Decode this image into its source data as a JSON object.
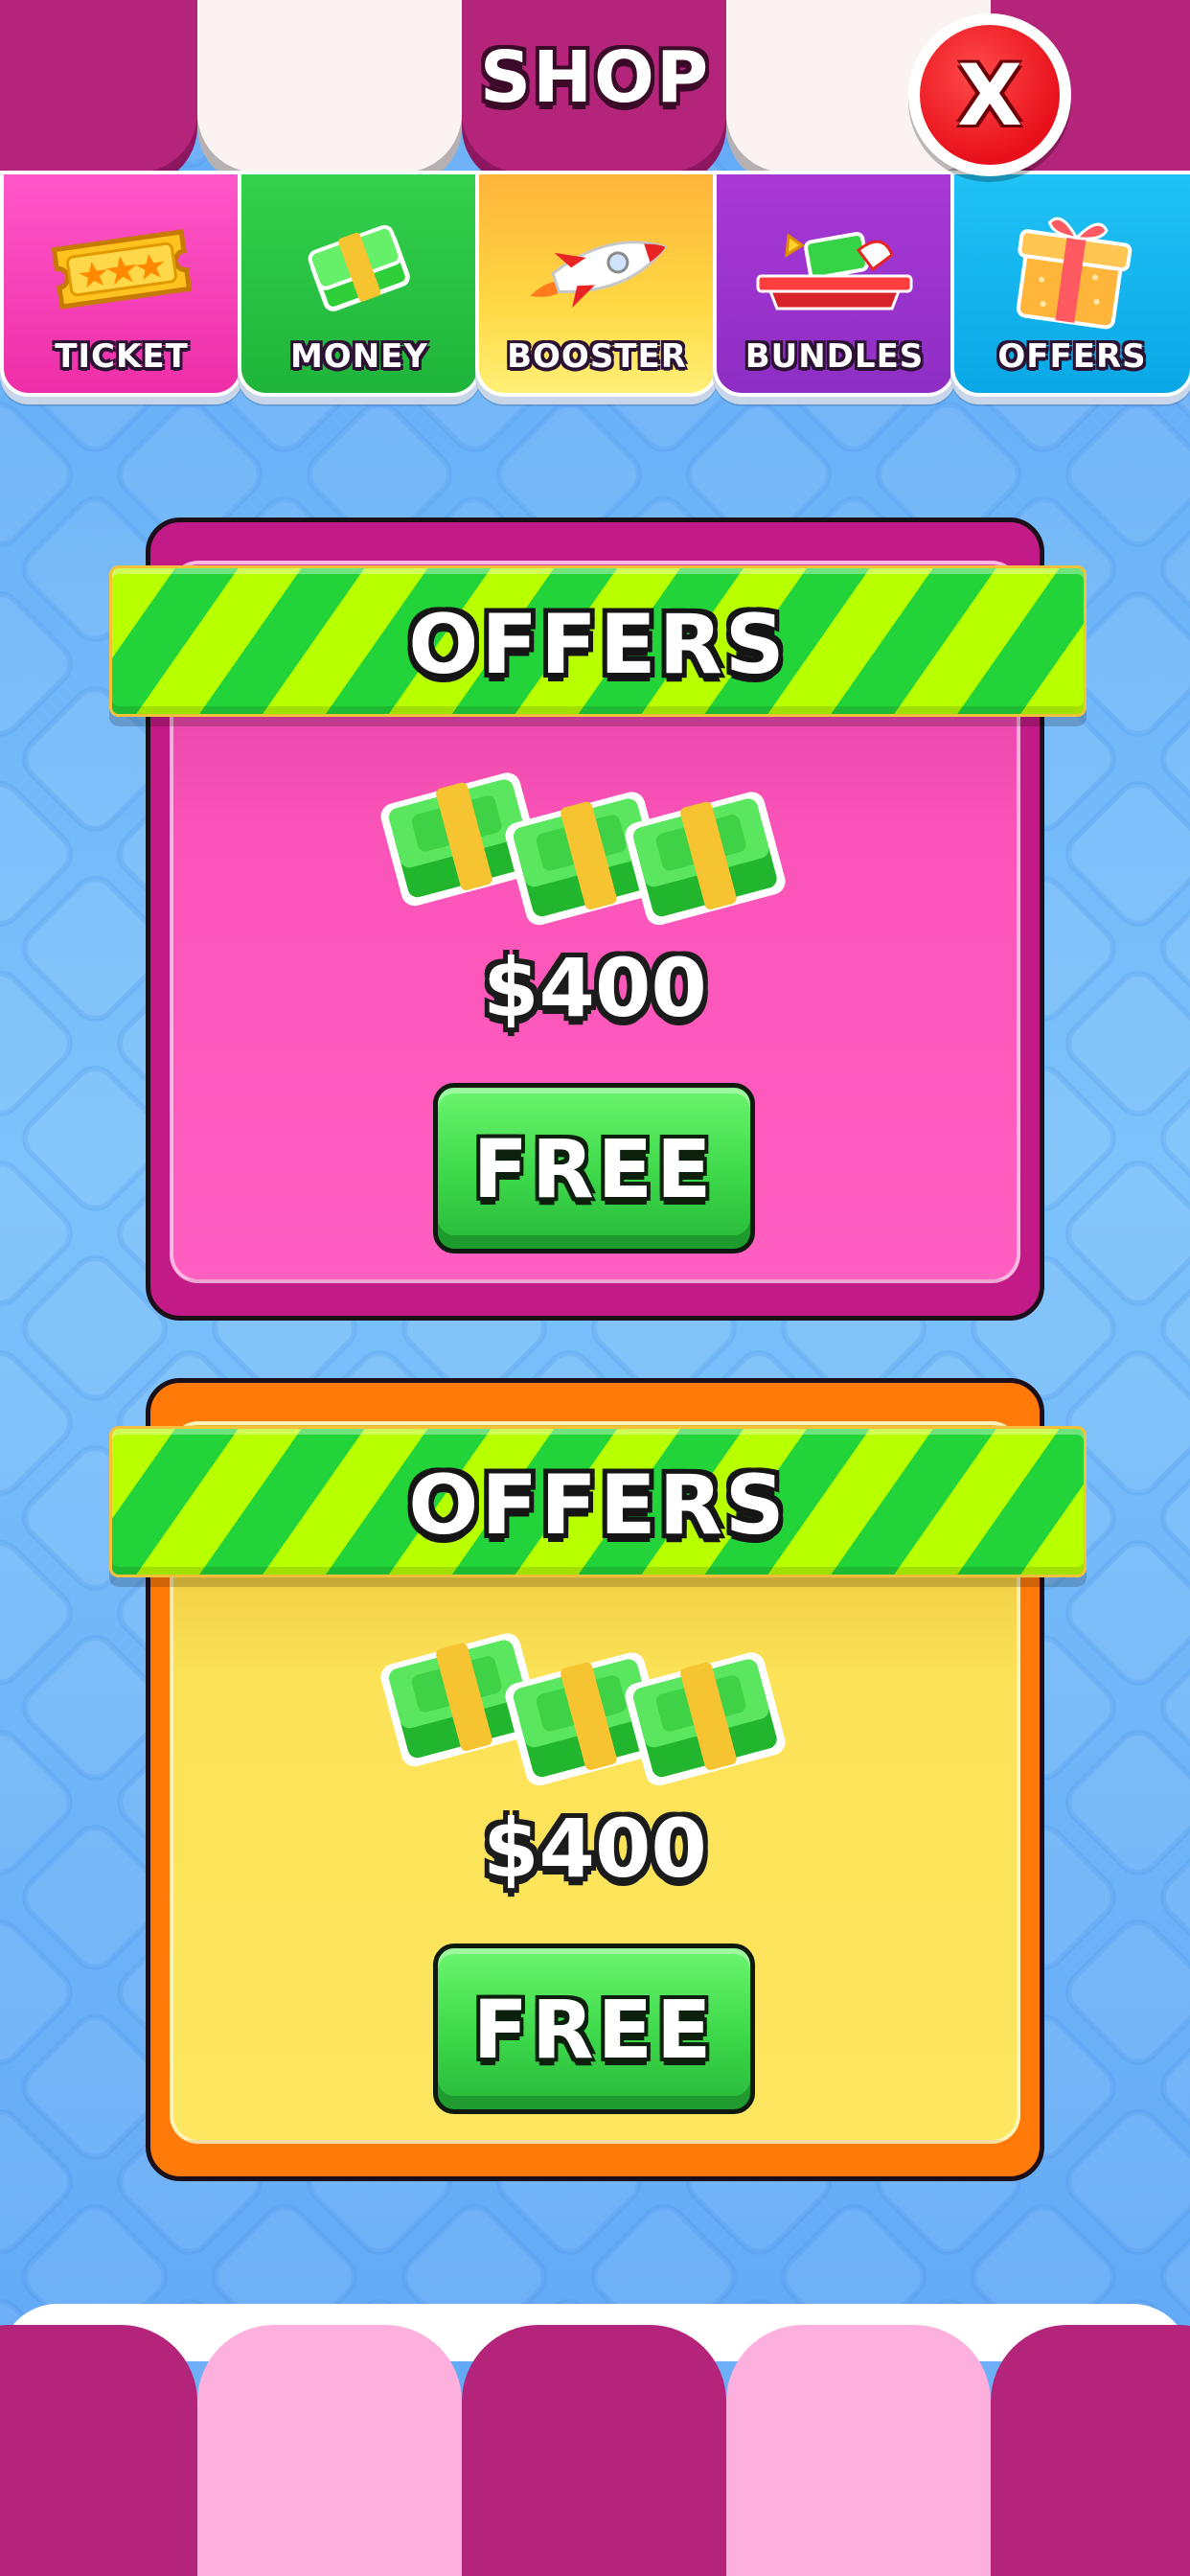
{
  "header": {
    "title": "SHOP",
    "close_label": "X"
  },
  "tabs": [
    {
      "label": "TICKET",
      "icon": "ticket-icon",
      "color": "#f43fb6"
    },
    {
      "label": "MONEY",
      "icon": "money-stack-icon",
      "color": "#27c443"
    },
    {
      "label": "BOOSTER",
      "icon": "rocket-icon",
      "color": "#ffc23a"
    },
    {
      "label": "BUNDLES",
      "icon": "bundle-chest-icon",
      "color": "#a43bd0"
    },
    {
      "label": "OFFERS",
      "icon": "gift-box-icon",
      "color": "#1ab8f2"
    }
  ],
  "offers": [
    {
      "banner": "OFFERS",
      "price": "$400",
      "button_label": "FREE",
      "theme": "pink",
      "accent": "#ff5fc0"
    },
    {
      "banner": "OFFERS",
      "price": "$400",
      "button_label": "FREE",
      "theme": "orange",
      "accent": "#fde660"
    }
  ],
  "colors": {
    "awning_dark": "#b4247a",
    "awning_light_top": "#fbf3f2",
    "awning_light_bottom": "#fdb0dd",
    "background": "#7cc2fb",
    "button_green": "#3dd84a",
    "ribbon_lime": "#b8ff00",
    "ribbon_green": "#22d43a",
    "close_red": "#e8101b"
  }
}
